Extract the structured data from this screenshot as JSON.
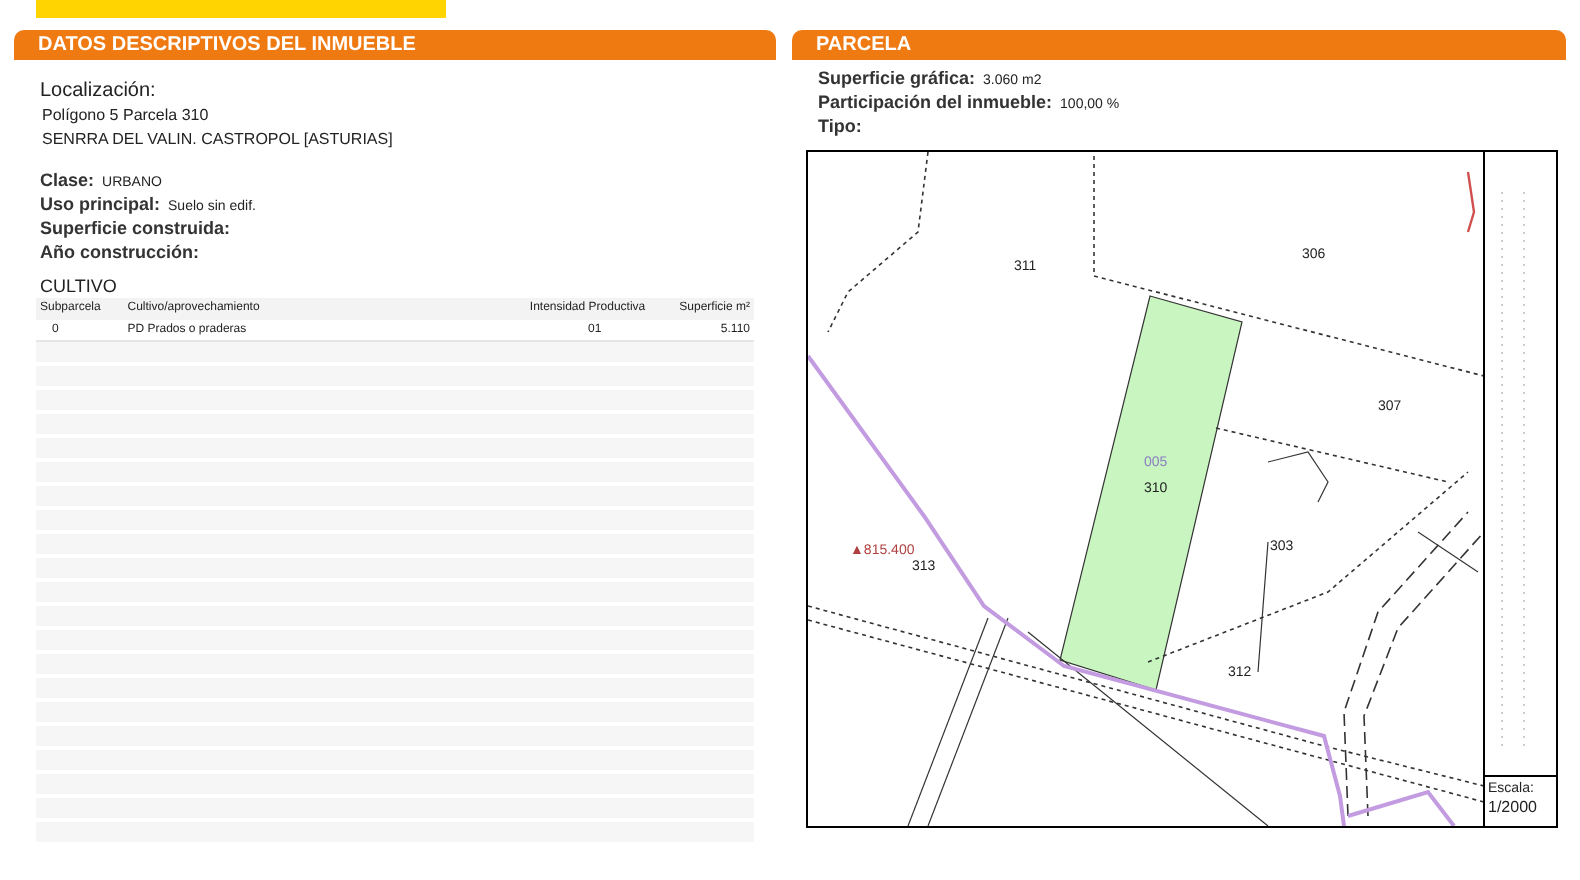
{
  "left_panel": {
    "title": "DATOS DESCRIPTIVOS DEL INMUEBLE",
    "location_label": "Localización:",
    "location_lines": [
      "Polígono 5 Parcela 310",
      "SENRRA DEL VALIN. CASTROPOL [ASTURIAS]"
    ],
    "fields": [
      {
        "label": "Clase:",
        "value": "URBANO"
      },
      {
        "label": "Uso principal:",
        "value": "Suelo sin edif."
      },
      {
        "label": "Superficie construida:"
      },
      {
        "label": "Año construcción:"
      }
    ],
    "table": {
      "title": "CULTIVO",
      "columns": [
        "Subparcela",
        "Cultivo/aprovechamiento",
        "Intensidad Productiva",
        "Superficie m²"
      ],
      "rows": [
        [
          "0",
          "PD Prados o praderas",
          "01",
          "5.110"
        ]
      ]
    }
  },
  "right_panel": {
    "title": "PARCELA",
    "fields": [
      {
        "label": "Superficie gráfica:",
        "value": "3.060 m2"
      },
      {
        "label": "Participación del inmueble:",
        "value": "100,00 %"
      },
      {
        "label": "Tipo:"
      }
    ],
    "map": {
      "parcel_labels": [
        {
          "text": "311",
          "kind": "parcel"
        },
        {
          "text": "306",
          "kind": "parcel"
        },
        {
          "text": "307",
          "kind": "parcel"
        },
        {
          "text": "005",
          "kind": "subparcel"
        },
        {
          "text": "310",
          "kind": "parcel"
        },
        {
          "text": "303",
          "kind": "parcel"
        },
        {
          "text": "313",
          "kind": "parcel"
        },
        {
          "text": "312",
          "kind": "parcel"
        },
        {
          "text": "▲815.400",
          "kind": "elevation"
        }
      ],
      "scale_label": "Escala:",
      "scale_value": "1/2000"
    }
  }
}
